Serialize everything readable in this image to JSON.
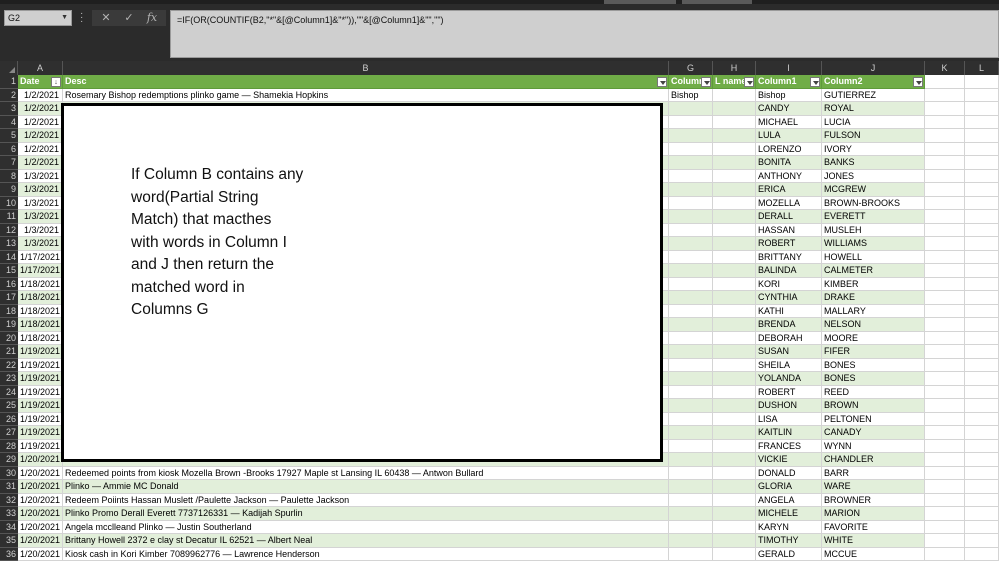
{
  "formula_bar": {
    "name_box": "G2",
    "cancel_icon": "✕",
    "enter_icon": "✓",
    "fx_label": "fx",
    "formula": "=IF(OR(COUNTIF(B2,\"*\"&[@Column1]&\"*\")),\"\"&[@Column1]&\"\",\"\")"
  },
  "columns": {
    "row_header_corner": "",
    "letters": [
      "A",
      "B",
      "G",
      "H",
      "I",
      "J",
      "K",
      "L"
    ]
  },
  "table": {
    "headers": [
      "Date",
      "Desc",
      "Column",
      "L name",
      "Column1",
      "Column2"
    ],
    "rows": [
      {
        "n": "2",
        "date": "1/2/2021",
        "desc": "Rosemary Bishop redemptions plinko game — Shamekia Hopkins",
        "g": "Bishop",
        "i": "Bishop",
        "j": "GUTIERREZ"
      },
      {
        "n": "3",
        "date": "1/2/2021",
        "desc": "",
        "g": "",
        "i": "CANDY",
        "j": "ROYAL"
      },
      {
        "n": "4",
        "date": "1/2/2021",
        "desc": "",
        "g": "",
        "i": "MICHAEL",
        "j": "LUCIA"
      },
      {
        "n": "5",
        "date": "1/2/2021",
        "desc": "",
        "g": "",
        "i": "LULA",
        "j": "FULSON"
      },
      {
        "n": "6",
        "date": "1/2/2021",
        "desc": "",
        "g": "",
        "i": "LORENZO",
        "j": "IVORY"
      },
      {
        "n": "7",
        "date": "1/2/2021",
        "desc": "",
        "g": "",
        "i": "BONITA",
        "j": "BANKS"
      },
      {
        "n": "8",
        "date": "1/3/2021",
        "desc": "",
        "g": "",
        "i": "ANTHONY",
        "j": "JONES"
      },
      {
        "n": "9",
        "date": "1/3/2021",
        "desc": "",
        "g": "",
        "i": "ERICA",
        "j": "MCGREW"
      },
      {
        "n": "10",
        "date": "1/3/2021",
        "desc": "",
        "g": "",
        "i": "MOZELLA",
        "j": "BROWN-BROOKS"
      },
      {
        "n": "11",
        "date": "1/3/2021",
        "desc": "",
        "g": "",
        "i": "DERALL",
        "j": "EVERETT"
      },
      {
        "n": "12",
        "date": "1/3/2021",
        "desc": "",
        "g": "",
        "i": "HASSAN",
        "j": "MUSLEH"
      },
      {
        "n": "13",
        "date": "1/3/2021",
        "desc": "",
        "g": "",
        "i": "ROBERT",
        "j": "WILLIAMS"
      },
      {
        "n": "14",
        "date": "1/17/2021",
        "desc": "",
        "g": "",
        "i": "BRITTANY",
        "j": "HOWELL"
      },
      {
        "n": "15",
        "date": "1/17/2021",
        "desc": "",
        "g": "",
        "i": "BALINDA",
        "j": "CALMETER"
      },
      {
        "n": "16",
        "date": "1/18/2021",
        "desc": "",
        "g": "",
        "i": "KORI",
        "j": "KIMBER"
      },
      {
        "n": "17",
        "date": "1/18/2021",
        "desc": "",
        "g": "",
        "i": "CYNTHIA",
        "j": "DRAKE"
      },
      {
        "n": "18",
        "date": "1/18/2021",
        "desc": "",
        "g": "",
        "i": "KATHI",
        "j": "MALLARY"
      },
      {
        "n": "19",
        "date": "1/18/2021",
        "desc": "",
        "g": "",
        "i": "BRENDA",
        "j": "NELSON"
      },
      {
        "n": "20",
        "date": "1/18/2021",
        "desc": "",
        "g": "",
        "i": "DEBORAH",
        "j": "MOORE"
      },
      {
        "n": "21",
        "date": "1/19/2021",
        "desc": "",
        "g": "",
        "i": "SUSAN",
        "j": "FIFER"
      },
      {
        "n": "22",
        "date": "1/19/2021",
        "desc": "",
        "g": "",
        "i": "SHEILA",
        "j": "BONES"
      },
      {
        "n": "23",
        "date": "1/19/2021",
        "desc": "",
        "g": "",
        "i": "YOLANDA",
        "j": "BONES"
      },
      {
        "n": "24",
        "date": "1/19/2021",
        "desc": "",
        "g": "",
        "i": "ROBERT",
        "j": "REED"
      },
      {
        "n": "25",
        "date": "1/19/2021",
        "desc": "",
        "g": "",
        "i": "DUSHON",
        "j": "BROWN"
      },
      {
        "n": "26",
        "date": "1/19/2021",
        "desc": "",
        "g": "",
        "i": "LISA",
        "j": "PELTONEN"
      },
      {
        "n": "27",
        "date": "1/19/2021",
        "desc": "",
        "g": "",
        "i": "KAITLIN",
        "j": "CANADY"
      },
      {
        "n": "28",
        "date": "1/19/2021",
        "desc": "",
        "g": "",
        "i": "FRANCES",
        "j": "WYNN"
      },
      {
        "n": "29",
        "date": "1/20/2021",
        "desc": "",
        "g": "",
        "i": "VICKIE",
        "j": "CHANDLER"
      },
      {
        "n": "30",
        "date": "1/20/2021",
        "desc": "Redeemed points from kiosk Mozella Brown -Brooks 17927 Maple st Lansing IL 60438 — Antwon Bullard",
        "g": "",
        "i": "DONALD",
        "j": "BARR"
      },
      {
        "n": "31",
        "date": "1/20/2021",
        "desc": "Plinko — Ammie MC Donald",
        "g": "",
        "i": "GLORIA",
        "j": "WARE"
      },
      {
        "n": "32",
        "date": "1/20/2021",
        "desc": "Redeem Poiints Hassan Muslett /Paulette Jackson — Paulette Jackson",
        "g": "",
        "i": "ANGELA",
        "j": "BROWNER"
      },
      {
        "n": "33",
        "date": "1/20/2021",
        "desc": "Plinko Promo Derall Everett 7737126331 — Kadijah Spurlin",
        "g": "",
        "i": "MICHELE",
        "j": "MARION"
      },
      {
        "n": "34",
        "date": "1/20/2021",
        "desc": "Angela mcclleand Plinko — Justin Southerland",
        "g": "",
        "i": "KARYN",
        "j": "FAVORITE"
      },
      {
        "n": "35",
        "date": "1/20/2021",
        "desc": "Brittany Howell 2372 e clay st Decatur IL 62521 — Albert Neal",
        "g": "",
        "i": "TIMOTHY",
        "j": "WHITE"
      },
      {
        "n": "36",
        "date": "1/20/2021",
        "desc": "Kiosk cash in Kori Kimber 7089962776 — Lawrence Henderson",
        "g": "",
        "i": "GERALD",
        "j": "MCCUE"
      }
    ]
  },
  "callout": {
    "lines": [
      "If Column B contains any",
      "word(Partial String",
      "Match) that macthes",
      "with words in Column I",
      "and J then return the",
      "matched word in",
      "Columns G"
    ]
  },
  "colors": {
    "table_header": "#70ad47",
    "band": "#e2efda"
  }
}
